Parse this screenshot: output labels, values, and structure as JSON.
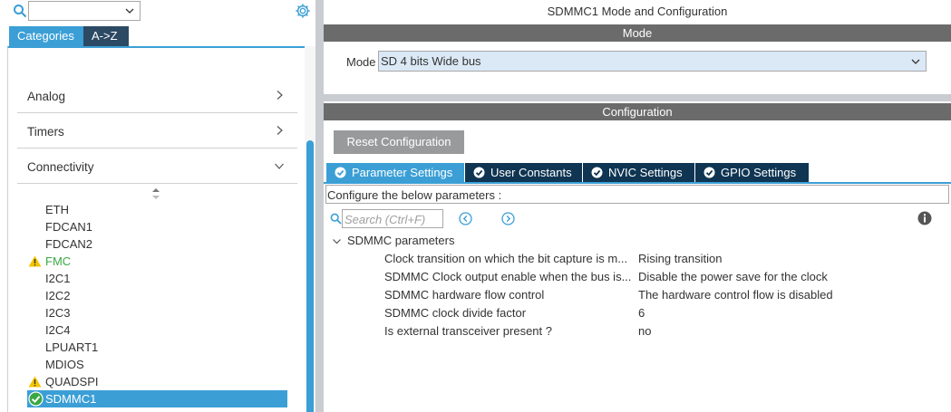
{
  "left_panel": {
    "search": {
      "value": ""
    },
    "tabs": [
      {
        "label": "Categories"
      },
      {
        "label": "A->Z"
      }
    ],
    "categories": [
      {
        "label": "Analog"
      },
      {
        "label": "Timers"
      },
      {
        "label": "Connectivity"
      }
    ],
    "peripherals": [
      {
        "label": "ETH",
        "status": "none"
      },
      {
        "label": "FDCAN1",
        "status": "none"
      },
      {
        "label": "FDCAN2",
        "status": "none"
      },
      {
        "label": "FMC",
        "status": "warning"
      },
      {
        "label": "I2C1",
        "status": "none"
      },
      {
        "label": "I2C2",
        "status": "none"
      },
      {
        "label": "I2C3",
        "status": "none"
      },
      {
        "label": "I2C4",
        "status": "none"
      },
      {
        "label": "LPUART1",
        "status": "none"
      },
      {
        "label": "MDIOS",
        "status": "none"
      },
      {
        "label": "QUADSPI",
        "status": "warning"
      },
      {
        "label": "SDMMC1",
        "status": "ok",
        "selected": true
      }
    ]
  },
  "right_panel": {
    "title": "SDMMC1 Mode and Configuration",
    "mode_section": {
      "header": "Mode",
      "mode_label": "Mode",
      "mode_value": "SD 4 bits Wide bus"
    },
    "config_section": {
      "header": "Configuration",
      "reset_button": "Reset Configuration",
      "tabs": [
        {
          "label": "Parameter Settings"
        },
        {
          "label": "User Constants"
        },
        {
          "label": "NVIC Settings"
        },
        {
          "label": "GPIO Settings"
        }
      ],
      "hint": "Configure the below parameters :",
      "search_placeholder": "Search (Ctrl+F)",
      "group": "SDMMC parameters",
      "params": [
        {
          "name": "Clock transition on which the bit capture is m...",
          "value": "Rising transition"
        },
        {
          "name": "SDMMC Clock output enable when the bus is...",
          "value": "Disable the power save for the clock"
        },
        {
          "name": "SDMMC hardware flow control",
          "value": "The hardware control flow is disabled"
        },
        {
          "name": "SDMMC clock divide factor",
          "value": "6"
        },
        {
          "name": "Is external transceiver present ?",
          "value": "no"
        }
      ]
    }
  },
  "colors": {
    "accent_blue": "#3b9fd6",
    "dark_navy": "#0f3553",
    "warning_green_text": "#3aa843",
    "warning_yellow": "#f5c400",
    "section_gray": "#6b6b6b"
  }
}
